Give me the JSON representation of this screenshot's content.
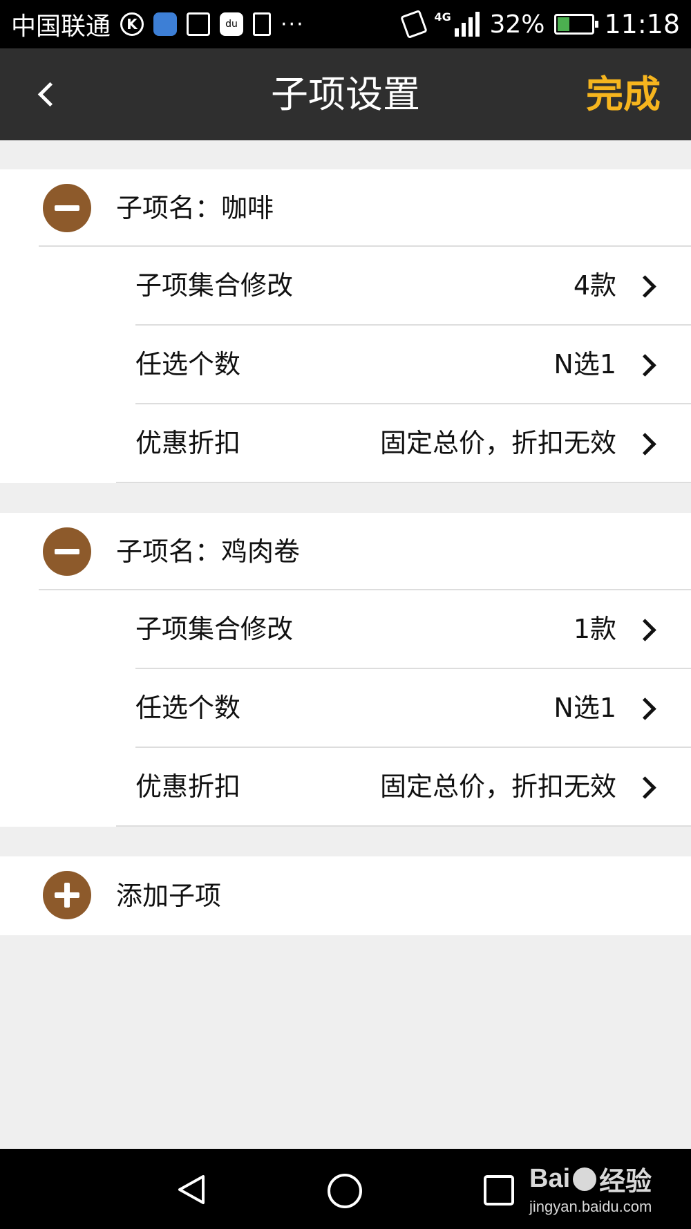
{
  "status_bar": {
    "carrier": "中国联通",
    "network": "4G",
    "battery_percent": "32%",
    "battery_level": 0.32,
    "time": "11:18",
    "more_indicator": "···",
    "icons": [
      "k-icon",
      "health-app-icon",
      "gallery-icon",
      "du-app-icon",
      "lock-screen-icon",
      "vibrate-icon",
      "signal-icon",
      "battery-icon"
    ]
  },
  "header": {
    "back_icon": "chevron-left-icon",
    "title": "子项设置",
    "done_label": "完成",
    "done_color": "#f6b51e"
  },
  "groups": [
    {
      "name_label": "子项名：咖啡",
      "remove_icon": "minus-circle-icon",
      "rows": [
        {
          "label": "子项集合修改",
          "value": "4款"
        },
        {
          "label": "任选个数",
          "value": "N选1"
        },
        {
          "label": "优惠折扣",
          "value": "固定总价，折扣无效"
        }
      ]
    },
    {
      "name_label": "子项名：鸡肉卷",
      "remove_icon": "minus-circle-icon",
      "rows": [
        {
          "label": "子项集合修改",
          "value": "1款"
        },
        {
          "label": "任选个数",
          "value": "N选1"
        },
        {
          "label": "优惠折扣",
          "value": "固定总价，折扣无效"
        }
      ]
    }
  ],
  "add_item": {
    "label": "添加子项",
    "icon": "plus-circle-icon"
  },
  "accent_color": "#8d5a2b",
  "nav_bar": {
    "icons": [
      "nav-back-icon",
      "nav-home-icon",
      "nav-recent-icon"
    ]
  },
  "watermark": {
    "brand": "Bai",
    "brand_suffix": "经验",
    "url": "jingyan.baidu.com"
  }
}
